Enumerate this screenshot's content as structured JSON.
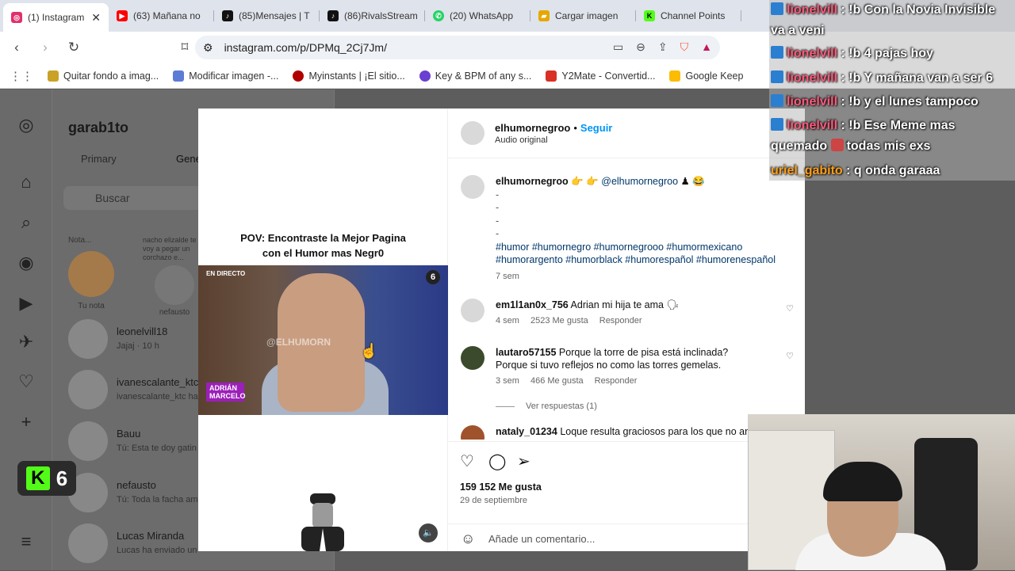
{
  "tabs": [
    {
      "label": "(1) Instagram",
      "icon": "instagram-icon",
      "color": "#e1306c",
      "active": true
    },
    {
      "label": "(63) Mañana no",
      "icon": "youtube-icon",
      "color": "#ff0000"
    },
    {
      "label": "(85)Mensajes | T",
      "icon": "tiktok-icon",
      "color": "#111111"
    },
    {
      "label": "(86)RivalsStream",
      "icon": "tiktok-icon",
      "color": "#111111"
    },
    {
      "label": "(20) WhatsApp",
      "icon": "whatsapp-icon",
      "color": "#25d366"
    },
    {
      "label": "Cargar imagen",
      "icon": "folder-icon",
      "color": "#e6a800"
    },
    {
      "label": "Channel Points",
      "icon": "kick-icon",
      "color": "#53fc18"
    }
  ],
  "address": {
    "url": "instagram.com/p/DPMq_2Cj7Jm/"
  },
  "bookmarks": [
    {
      "label": "Quitar fondo a imag...",
      "color": "#c9a227"
    },
    {
      "label": "Modificar imagen -...",
      "color": "#5b7bd5"
    },
    {
      "label": "Myinstants | ¡El sitio...",
      "color": "#b00000"
    },
    {
      "label": "Key & BPM of any s...",
      "color": "#6b3fd0"
    },
    {
      "label": "Y2Mate - Convertid...",
      "color": "#d93025"
    },
    {
      "label": "Google Keep",
      "color": "#fbbc04"
    }
  ],
  "inbox": {
    "username": "garab1to",
    "tab_primary": "Primary",
    "tab_general": "Gene",
    "search_placeholder": "Buscar",
    "notes": [
      {
        "text": "Nota...",
        "name": "Tu nota"
      },
      {
        "text": "nacho elizalde te voy a pegar un corchazo e...",
        "name": "nefausto"
      }
    ],
    "chats": [
      {
        "name": "leonelvill18",
        "preview": "Jajaj · 10 h"
      },
      {
        "name": "ivanescalante_ktc",
        "preview": "ivanescalante_ktc ha"
      },
      {
        "name": "Bauu",
        "preview": "Tú: Esta te doy gatin"
      },
      {
        "name": "nefausto",
        "preview": "Tú: Toda la facha am"
      },
      {
        "name": "Lucas Miranda",
        "preview": "Lucas ha enviado un"
      }
    ]
  },
  "post": {
    "video_title_line1": "POV: Encontraste la Mejor Pagina",
    "video_title_line2": "con el Humor mas Negr0",
    "video_live": "EN DIRECTO",
    "video_channel": "6",
    "video_watermark": "@ELHUMORN",
    "video_lower_third": "ADRIÁN MARCELO",
    "author": "elhumornegroo",
    "follow_label": "Seguir",
    "audio": "Audio original",
    "caption_author": "elhumornegroo",
    "caption_mention": "@elhumornegroo",
    "caption_dashes": [
      "-",
      "-",
      "-",
      "-"
    ],
    "caption_tags": "#humor #humornegro #humornegrooo #humormexicano #humorargento #humorblack #humorespañol #humorenespañol",
    "caption_time": "7 sem",
    "comments": [
      {
        "user": "em1l1an0x_756",
        "text": "Adrian mi hija te ama",
        "time": "4 sem",
        "likes": "2523 Me gusta",
        "reply": "Responder"
      },
      {
        "user": "lautaro57155",
        "text": "Porque la torre de pisa está inclinada? Porque si tuvo reflejos no como las torres gemelas.",
        "time": "3 sem",
        "likes": "466 Me gusta",
        "reply": "Responder"
      },
      {
        "user": "nataly_01234",
        "text": "Loque resulta graciosos para los que no an"
      }
    ],
    "view_replies": "Ver respuestas (1)",
    "like_count": "159 152 Me gusta",
    "date": "29 de septiembre",
    "add_comment_placeholder": "Añade un comentario..."
  },
  "stream_chat": [
    {
      "user": "lionelvill",
      "text": ": !b Con la Novia Invisible va a veni"
    },
    {
      "user": "lionelvill",
      "text": ": !b 4 pajas hoy"
    },
    {
      "user": "lionelvill",
      "text": ": !b Y mañana van a ser 6"
    },
    {
      "user": "lionelvill",
      "text": ": !b y el lunes tampoco"
    },
    {
      "user": "lionelvill",
      "text": ": !b Ese Meme mas quemado",
      "tail": "todas mis exs"
    },
    {
      "user": "uriel_gabito",
      "text": ": q onda garaaa"
    }
  ],
  "kick_badge": {
    "letter": "K",
    "count": "6"
  }
}
